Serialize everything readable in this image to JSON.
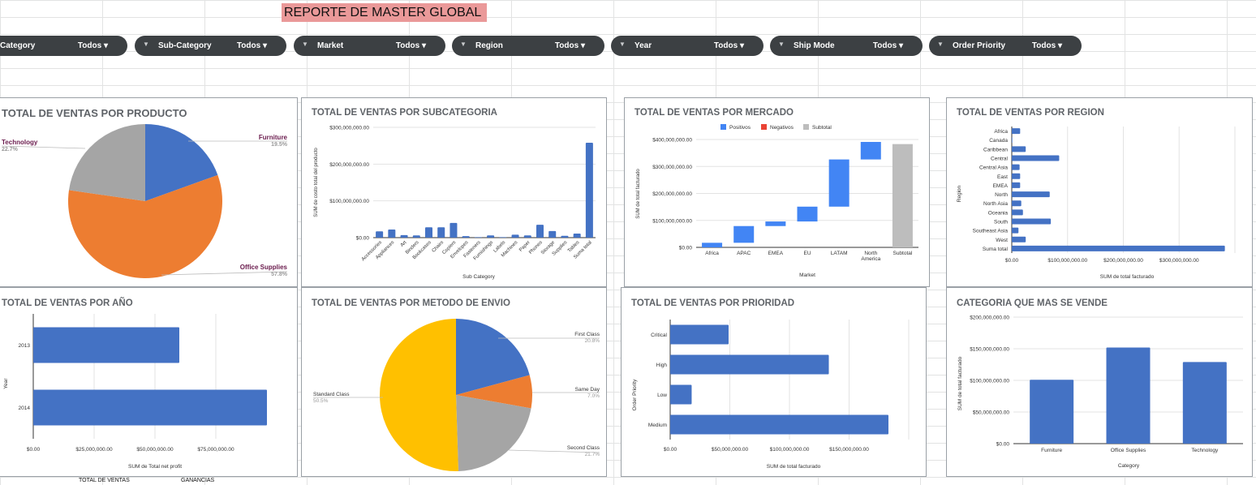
{
  "report_title": "REPORTE DE MASTER GLOBAL",
  "filters": [
    {
      "label": "Category",
      "value": "Todos"
    },
    {
      "label": "Sub-Category",
      "value": "Todos"
    },
    {
      "label": "Market",
      "value": "Todos"
    },
    {
      "label": "Region",
      "value": "Todos"
    },
    {
      "label": "Year",
      "value": "Todos"
    },
    {
      "label": "Ship Mode",
      "value": "Todos"
    },
    {
      "label": "Order Priority",
      "value": "Todos"
    }
  ],
  "footer": {
    "col1": "TOTAL DE VENTAS",
    "col2": "GANANCIAS"
  },
  "colors": {
    "blue": "#4472c4",
    "orange": "#ed7d31",
    "gray": "#a5a5a5",
    "yellow": "#ffc000",
    "wf_pos": "#4285f4",
    "wf_neg": "#ea4335",
    "wf_sub": "#bdbdbd"
  },
  "chart_data": [
    {
      "id": "c1",
      "type": "pie",
      "title": "TOTAL DE VENTAS POR PRODUCTO",
      "slices": [
        {
          "label": "Furniture",
          "pct": 19.5,
          "value_label": "19.5%"
        },
        {
          "label": "Office Supplies",
          "pct": 57.8,
          "value_label": "57.8%"
        },
        {
          "label": "Technology",
          "pct": 22.7,
          "value_label": "22.7%"
        }
      ]
    },
    {
      "id": "c2",
      "type": "bar",
      "title": "TOTAL DE VENTAS POR SUBCATEGORIA",
      "xlabel": "Sub Category",
      "ylabel": "SUM de costo total del producto",
      "yticks": [
        "$0.00",
        "$100,000,000.00",
        "$200,000,000.00",
        "$300,000,000.00"
      ],
      "ylim": [
        0,
        300000000
      ],
      "categories": [
        "Accessories",
        "Appliances",
        "Art",
        "Binders",
        "Bookcases",
        "Chairs",
        "Copiers",
        "Envelopes",
        "Fasteners",
        "Furnishings",
        "Labels",
        "Machines",
        "Paper",
        "Phones",
        "Storage",
        "Supplies",
        "Tables",
        "Suma total"
      ],
      "values": [
        17000000,
        22000000,
        7000000,
        6000000,
        28000000,
        28000000,
        40000000,
        4000000,
        1500000,
        6000000,
        1500000,
        8000000,
        6000000,
        35000000,
        18000000,
        5000000,
        11000000,
        258000000
      ]
    },
    {
      "id": "c3",
      "type": "bar",
      "title": "TOTAL DE VENTAS POR MERCADO",
      "subtype": "waterfall",
      "legend": [
        "Positivos",
        "Negativos",
        "Subtotal"
      ],
      "xlabel": "Market",
      "ylabel": "SUM de total facturado",
      "yticks": [
        "$0.00",
        "$100,000,000.00",
        "$200,000,000.00",
        "$300,000,000.00",
        "$400,000,000.00"
      ],
      "ylim": [
        0,
        400000000
      ],
      "categories": [
        "Africa",
        "APAC",
        "EMEA",
        "EU",
        "LATAM",
        "North America",
        "Subtotal"
      ],
      "values": [
        17000000,
        62000000,
        17000000,
        55000000,
        175000000,
        65000000,
        383000000
      ]
    },
    {
      "id": "c4",
      "type": "bar",
      "orientation": "horizontal",
      "title": "TOTAL DE VENTAS POR REGION",
      "xlabel": "SUM de total facturado",
      "ylabel": "Region",
      "xticks": [
        "$0.00",
        "$100,000,000.00",
        "$200,000,000.00",
        "$300,000,000.00"
      ],
      "xlim": [
        0,
        400000000
      ],
      "categories": [
        "Africa",
        "Canada",
        "Caribbean",
        "Central",
        "Central Asia",
        "East",
        "EMEA",
        "North",
        "North Asia",
        "Oceania",
        "South",
        "Southeast Asia",
        "West",
        "Suma total"
      ],
      "values": [
        15000000,
        1000000,
        25000000,
        85000000,
        14000000,
        15000000,
        15000000,
        68000000,
        17000000,
        20000000,
        70000000,
        12000000,
        25000000,
        382000000
      ]
    },
    {
      "id": "c5",
      "type": "bar",
      "orientation": "horizontal",
      "title": "TOTAL DE VENTAS POR AÑO",
      "xlabel": "SUM de Total net profit",
      "ylabel": "Year",
      "xticks": [
        "$0.00",
        "$25,000,000.00",
        "$50,000,000.00",
        "$75,000,000.00"
      ],
      "xlim": [
        0,
        100000000
      ],
      "categories": [
        "2013",
        "2014"
      ],
      "values": [
        60000000,
        96000000
      ]
    },
    {
      "id": "c6",
      "type": "pie",
      "title": "TOTAL DE VENTAS POR METODO DE ENVIO",
      "slices": [
        {
          "label": "First Class",
          "pct": 20.8,
          "value_label": "20.8%"
        },
        {
          "label": "Same Day",
          "pct": 7.0,
          "value_label": "7.0%"
        },
        {
          "label": "Second Class",
          "pct": 21.7,
          "value_label": "21.7%"
        },
        {
          "label": "Standard Class",
          "pct": 50.5,
          "value_label": "50.5%"
        }
      ]
    },
    {
      "id": "c7",
      "type": "bar",
      "orientation": "horizontal",
      "title": "TOTAL DE VENTAS POR PRIORIDAD",
      "xlabel": "SUM de total facturado",
      "ylabel": "Order Priority",
      "xticks": [
        "$0.00",
        "$50,000,000.00",
        "$100,000,000.00",
        "$150,000,000.00"
      ],
      "xlim": [
        0,
        200000000
      ],
      "categories": [
        "Critical",
        "High",
        "Low",
        "Medium"
      ],
      "values": [
        49000000,
        133000000,
        18000000,
        183000000
      ]
    },
    {
      "id": "c8",
      "type": "bar",
      "title": "CATEGORIA QUE MAS SE VENDE",
      "xlabel": "Category",
      "ylabel": "SUM de total facturado",
      "yticks": [
        "$0.00",
        "$50,000,000.00",
        "$100,000,000.00",
        "$150,000,000.00",
        "$200,000,000.00"
      ],
      "ylim": [
        0,
        200000000
      ],
      "categories": [
        "Furniture",
        "Office Supplies",
        "Technology"
      ],
      "values": [
        101000000,
        152000000,
        129000000
      ]
    }
  ]
}
